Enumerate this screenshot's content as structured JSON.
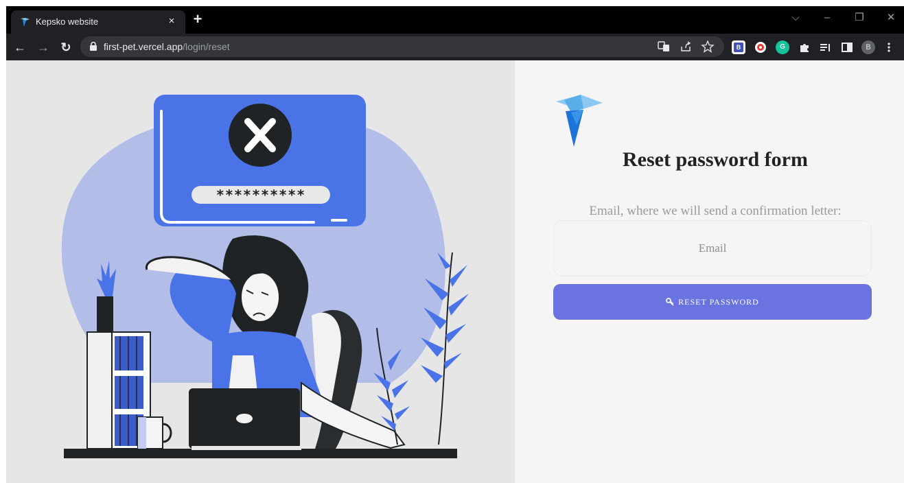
{
  "browser": {
    "tab_title": "Kepsko website",
    "tab_close": "×",
    "new_tab": "+",
    "url_host": "first-pet.vercel.app",
    "url_path": "/login/reset",
    "profile_initial": "B",
    "window_controls": {
      "dropdown": "⌵",
      "minimize": "–",
      "restore": "❐",
      "close": "✕"
    },
    "nav": {
      "back": "←",
      "forward": "→",
      "reload": "↻"
    },
    "extensions": [
      {
        "name": "translate-icon"
      },
      {
        "name": "share-icon"
      },
      {
        "name": "bookmark-star-icon"
      },
      {
        "name": "ext-b-icon",
        "label": "B",
        "color": "#3f51b5"
      },
      {
        "name": "ext-red-circle-icon",
        "color": "#e53935"
      },
      {
        "name": "grammarly-icon",
        "label": "G",
        "color": "#15c39a"
      },
      {
        "name": "puzzle-icon"
      },
      {
        "name": "reading-list-icon"
      },
      {
        "name": "side-panel-icon"
      },
      {
        "name": "profile-icon"
      },
      {
        "name": "menu-icon"
      }
    ]
  },
  "illustration": {
    "password_mask": "**********"
  },
  "form": {
    "title": "Reset password form",
    "email_label": "Email, where we will send a confirmation letter:",
    "email_placeholder": "Email",
    "email_value": "",
    "submit_label": "RESET PASSWORD",
    "accent_color": "#6a73e0"
  }
}
